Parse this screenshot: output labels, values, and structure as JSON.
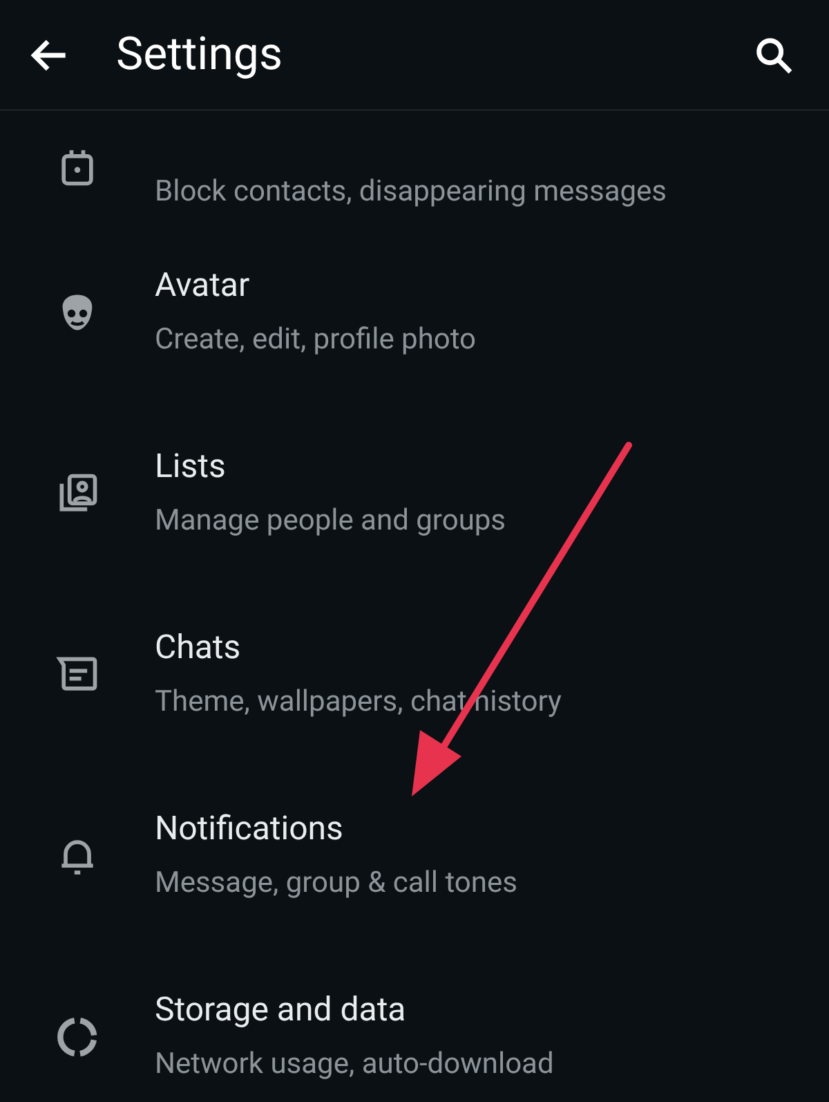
{
  "header": {
    "title": "Settings"
  },
  "items": [
    {
      "kind": "privacy",
      "subtitle": "Block contacts, disappearing messages"
    },
    {
      "kind": "avatar",
      "title": "Avatar",
      "subtitle": "Create, edit, profile photo"
    },
    {
      "kind": "lists",
      "title": "Lists",
      "subtitle": "Manage people and groups"
    },
    {
      "kind": "chats",
      "title": "Chats",
      "subtitle": "Theme, wallpapers, chat history"
    },
    {
      "kind": "notifications",
      "title": "Notifications",
      "subtitle": "Message, group & call tones"
    },
    {
      "kind": "storage",
      "title": "Storage and data",
      "subtitle": "Network usage, auto-download"
    }
  ]
}
